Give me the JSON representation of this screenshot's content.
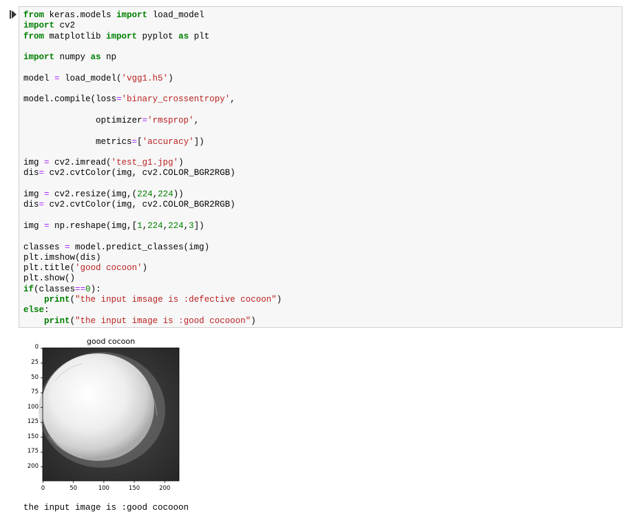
{
  "cell": {
    "code_lines": [
      [
        [
          "kw",
          "from"
        ],
        [
          "t",
          " keras.models "
        ],
        [
          "kw",
          "import"
        ],
        [
          "t",
          " load_model"
        ]
      ],
      [
        [
          "kw",
          "import"
        ],
        [
          "t",
          " cv2"
        ]
      ],
      [
        [
          "kw",
          "from"
        ],
        [
          "t",
          " matplotlib "
        ],
        [
          "kw",
          "import"
        ],
        [
          "t",
          " pyplot "
        ],
        [
          "kw",
          "as"
        ],
        [
          "t",
          " plt"
        ]
      ],
      [
        [
          "t",
          ""
        ]
      ],
      [
        [
          "kw",
          "import"
        ],
        [
          "t",
          " numpy "
        ],
        [
          "kw",
          "as"
        ],
        [
          "t",
          " np"
        ]
      ],
      [
        [
          "t",
          ""
        ]
      ],
      [
        [
          "t",
          "model "
        ],
        [
          "op",
          "="
        ],
        [
          "t",
          " load_model("
        ],
        [
          "st",
          "'vgg1.h5'"
        ],
        [
          "t",
          ")"
        ]
      ],
      [
        [
          "t",
          ""
        ]
      ],
      [
        [
          "t",
          "model.compile(loss"
        ],
        [
          "op",
          "="
        ],
        [
          "st",
          "'binary_crossentropy'"
        ],
        [
          "t",
          ","
        ]
      ],
      [
        [
          "t",
          ""
        ]
      ],
      [
        [
          "t",
          "              optimizer"
        ],
        [
          "op",
          "="
        ],
        [
          "st",
          "'rmsprop'"
        ],
        [
          "t",
          ","
        ]
      ],
      [
        [
          "t",
          ""
        ]
      ],
      [
        [
          "t",
          "              metrics"
        ],
        [
          "op",
          "="
        ],
        [
          "t",
          "["
        ],
        [
          "st",
          "'accuracy'"
        ],
        [
          "t",
          "])"
        ]
      ],
      [
        [
          "t",
          ""
        ]
      ],
      [
        [
          "t",
          "img "
        ],
        [
          "op",
          "="
        ],
        [
          "t",
          " cv2.imread("
        ],
        [
          "st",
          "'test_g1.jpg'"
        ],
        [
          "t",
          ")"
        ]
      ],
      [
        [
          "t",
          "dis"
        ],
        [
          "op",
          "="
        ],
        [
          "t",
          " cv2.cvtColor(img, cv2.COLOR_BGR2RGB)"
        ]
      ],
      [
        [
          "t",
          ""
        ]
      ],
      [
        [
          "t",
          "img "
        ],
        [
          "op",
          "="
        ],
        [
          "t",
          " cv2.resize(img,("
        ],
        [
          "nu",
          "224"
        ],
        [
          "t",
          ","
        ],
        [
          "nu",
          "224"
        ],
        [
          "t",
          "))"
        ]
      ],
      [
        [
          "t",
          "dis"
        ],
        [
          "op",
          "="
        ],
        [
          "t",
          " cv2.cvtColor(img, cv2.COLOR_BGR2RGB)"
        ]
      ],
      [
        [
          "t",
          ""
        ]
      ],
      [
        [
          "t",
          "img "
        ],
        [
          "op",
          "="
        ],
        [
          "t",
          " np.reshape(img,["
        ],
        [
          "nu",
          "1"
        ],
        [
          "t",
          ","
        ],
        [
          "nu",
          "224"
        ],
        [
          "t",
          ","
        ],
        [
          "nu",
          "224"
        ],
        [
          "t",
          ","
        ],
        [
          "nu",
          "3"
        ],
        [
          "t",
          "])"
        ]
      ],
      [
        [
          "t",
          ""
        ]
      ],
      [
        [
          "t",
          "classes "
        ],
        [
          "op",
          "="
        ],
        [
          "t",
          " model.predict_classes(img)"
        ]
      ],
      [
        [
          "t",
          "plt.imshow(dis)"
        ]
      ],
      [
        [
          "t",
          "plt.title("
        ],
        [
          "st",
          "'good cocoon'"
        ],
        [
          "t",
          ")"
        ]
      ],
      [
        [
          "t",
          "plt.show()"
        ]
      ],
      [
        [
          "kw",
          "if"
        ],
        [
          "t",
          "(classes"
        ],
        [
          "op",
          "=="
        ],
        [
          "nu",
          "0"
        ],
        [
          "t",
          "):"
        ]
      ],
      [
        [
          "t",
          "    "
        ],
        [
          "kw",
          "print"
        ],
        [
          "t",
          "("
        ],
        [
          "st",
          "\"the input imsage is :defective cocoon\""
        ],
        [
          "t",
          ")"
        ]
      ],
      [
        [
          "kw",
          "else"
        ],
        [
          "t",
          ":"
        ]
      ],
      [
        [
          "t",
          "    "
        ],
        [
          "kw",
          "print"
        ],
        [
          "t",
          "("
        ],
        [
          "st",
          "\"the input image is :good cocooon\""
        ],
        [
          "t",
          ")"
        ]
      ]
    ]
  },
  "figure": {
    "title": "good cocoon",
    "yticks": [
      "0",
      "25",
      "50",
      "75",
      "100",
      "125",
      "150",
      "175",
      "200"
    ],
    "xticks": [
      "0",
      "50",
      "100",
      "150",
      "200"
    ]
  },
  "output_text": "the input image is :good cocooon",
  "colors": {
    "keyword": "#008000",
    "string": "#ba2121",
    "number": "#008000",
    "operator": "#aa22ff",
    "cell_bg": "#f7f7f7"
  }
}
